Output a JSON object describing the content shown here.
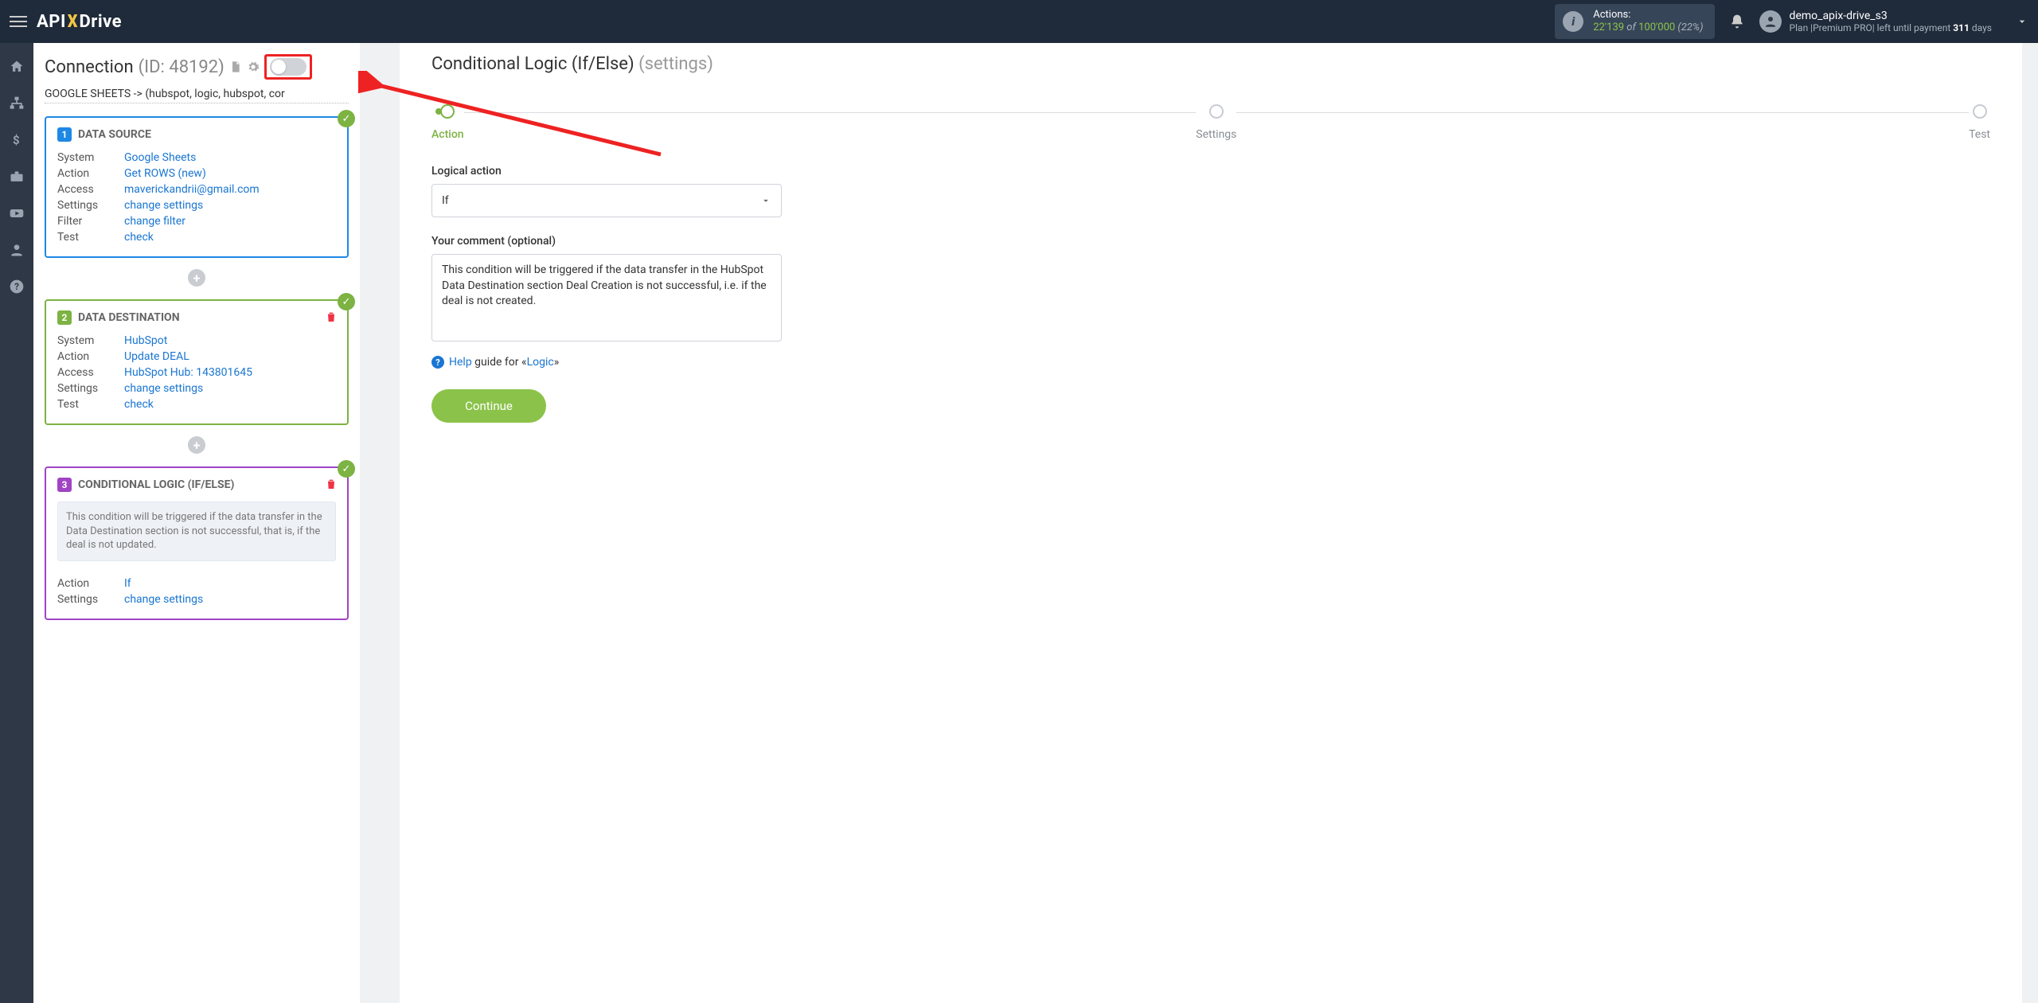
{
  "brand": {
    "part1": "API",
    "part2": "Drive"
  },
  "topnav": {
    "actions_label": "Actions:",
    "actions_count": "22'139",
    "actions_of": "of",
    "actions_total": "100'000",
    "actions_pct": "(22%)",
    "user_name": "demo_apix-drive_s3",
    "user_plan_prefix": "Plan |Premium PRO| left until payment ",
    "user_plan_days": "311",
    "user_plan_suffix": " days"
  },
  "sidebar": {
    "connection_label": "Connection",
    "connection_id": "(ID: 48192)",
    "path": "GOOGLE SHEETS -> (hubspot, logic, hubspot, cor",
    "card1": {
      "num": "1",
      "title": "DATA SOURCE",
      "rows": [
        {
          "k": "System",
          "v": "Google Sheets"
        },
        {
          "k": "Action",
          "v": "Get ROWS (new)"
        },
        {
          "k": "Access",
          "v": "maverickandrii@gmail.com"
        },
        {
          "k": "Settings",
          "v": "change settings"
        },
        {
          "k": "Filter",
          "v": "change filter"
        },
        {
          "k": "Test",
          "v": "check"
        }
      ]
    },
    "card2": {
      "num": "2",
      "title": "DATA DESTINATION",
      "rows": [
        {
          "k": "System",
          "v": "HubSpot"
        },
        {
          "k": "Action",
          "v": "Update DEAL"
        },
        {
          "k": "Access",
          "v": "HubSpot Hub: 143801645"
        },
        {
          "k": "Settings",
          "v": "change settings"
        },
        {
          "k": "Test",
          "v": "check"
        }
      ]
    },
    "card3": {
      "num": "3",
      "title": "CONDITIONAL LOGIC (IF/ELSE)",
      "desc": "This condition will be triggered if the data transfer in the Data Destination section is not successful, that is, if the deal is not updated.",
      "rows": [
        {
          "k": "Action",
          "v": "If"
        },
        {
          "k": "Settings",
          "v": "change settings"
        }
      ]
    }
  },
  "main": {
    "title": "Conditional Logic (If/Else)",
    "title_suffix": "(settings)",
    "steps": [
      "Action",
      "Settings",
      "Test"
    ],
    "active_step": 0,
    "logical_action_label": "Logical action",
    "logical_action_value": "If",
    "comment_label": "Your comment (optional)",
    "comment_value": "This condition will be triggered if the data transfer in the HubSpot Data Destination section Deal Creation is not successful, i.e. if the deal is not created.",
    "help_word": "Help",
    "help_tail": " guide for «",
    "help_link": "Logic",
    "help_close": "»",
    "continue": "Continue"
  }
}
